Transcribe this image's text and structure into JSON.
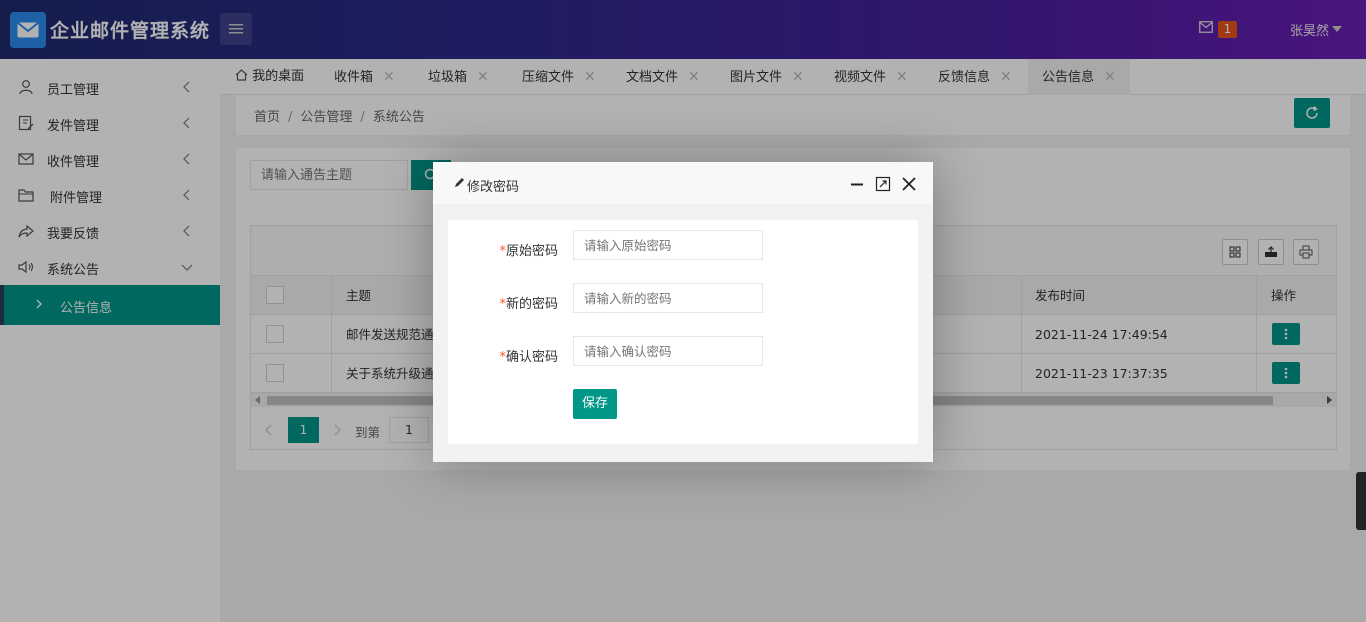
{
  "header": {
    "app_title": "企业邮件管理系统",
    "mail_count": "1",
    "user_name": "张昊然"
  },
  "sidebar": {
    "items": [
      {
        "label": "员工管理",
        "icon": "user-icon"
      },
      {
        "label": "发件管理",
        "icon": "edit-icon"
      },
      {
        "label": "收件管理",
        "icon": "mail-icon"
      },
      {
        "label": "附件管理",
        "icon": "folder-icon"
      },
      {
        "label": "我要反馈",
        "icon": "share-icon"
      },
      {
        "label": "系统公告",
        "icon": "speaker-icon"
      }
    ],
    "sub_item": "公告信息"
  },
  "tabs": [
    {
      "label": "我的桌面"
    },
    {
      "label": "收件箱"
    },
    {
      "label": "垃圾箱"
    },
    {
      "label": "压缩文件"
    },
    {
      "label": "文档文件"
    },
    {
      "label": "图片文件"
    },
    {
      "label": "视频文件"
    },
    {
      "label": "反馈信息"
    },
    {
      "label": "公告信息"
    }
  ],
  "breadcrumb": [
    "首页",
    "公告管理",
    "系统公告"
  ],
  "search": {
    "placeholder": "请输入通告主题"
  },
  "table": {
    "headers": {
      "subject": "主题",
      "publish_time": "发布时间",
      "actions": "操作"
    },
    "rows": [
      {
        "subject": "邮件发送规范通知",
        "publish_time": "2021-11-24 17:49:54"
      },
      {
        "subject": "关于系统升级通知",
        "publish_time": "2021-11-23 17:37:35"
      }
    ]
  },
  "pager": {
    "current": "1",
    "goto_label": "到第",
    "goto_value": "1"
  },
  "dialog": {
    "title": "修改密码",
    "fields": [
      {
        "required_mark": "*",
        "label": "原始密码",
        "placeholder": "请输入原始密码"
      },
      {
        "required_mark": "*",
        "label": "新的密码",
        "placeholder": "请输入新的密码"
      },
      {
        "required_mark": "*",
        "label": "确认密码",
        "placeholder": "请输入确认密码"
      }
    ],
    "save_label": "保存"
  },
  "colors": {
    "accent": "#009688",
    "badge": "#e5541b",
    "header_start": "#1e2a6e",
    "header_end": "#6a1fb4"
  }
}
